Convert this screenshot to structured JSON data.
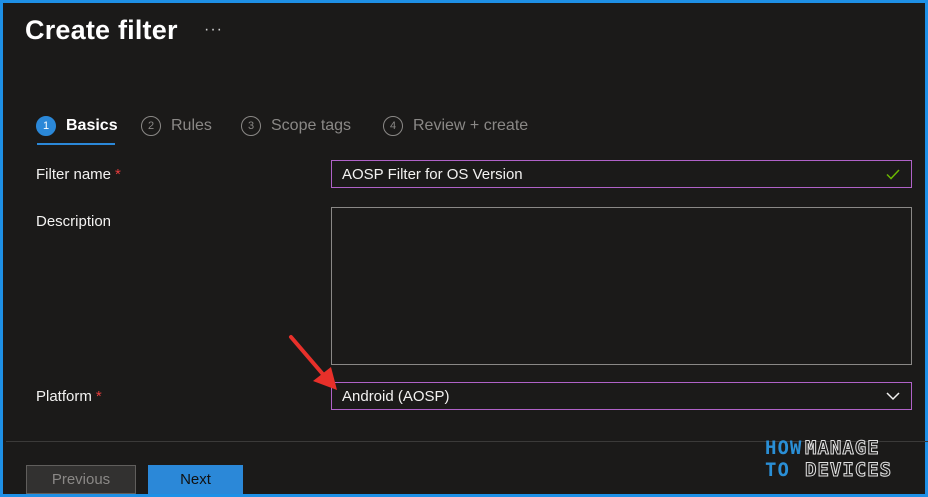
{
  "header": {
    "title": "Create filter",
    "more_label": "···"
  },
  "wizard": {
    "steps": [
      {
        "number": "1",
        "label": "Basics",
        "active": true
      },
      {
        "number": "2",
        "label": "Rules",
        "active": false
      },
      {
        "number": "3",
        "label": "Scope tags",
        "active": false
      },
      {
        "number": "4",
        "label": "Review + create",
        "active": false
      }
    ]
  },
  "form": {
    "filter_name": {
      "label": "Filter name",
      "required_mark": "*",
      "value": "AOSP Filter for OS Version",
      "valid_icon": "check-icon"
    },
    "description": {
      "label": "Description",
      "value": ""
    },
    "platform": {
      "label": "Platform",
      "required_mark": "*",
      "value": "Android (AOSP)",
      "icon": "chevron-down-icon"
    }
  },
  "footer": {
    "previous_label": "Previous",
    "next_label": "Next"
  },
  "watermark": {
    "line1_left": "HOW",
    "line2_left": "TO",
    "line1_right": "MANAGE",
    "line2_right": "DEVICES"
  },
  "colors": {
    "accent": "#2b88d8",
    "focus_border": "#b062c8",
    "required": "#e83d3d",
    "annotation_arrow": "#e8302a",
    "valid_check": "#6bb700"
  }
}
